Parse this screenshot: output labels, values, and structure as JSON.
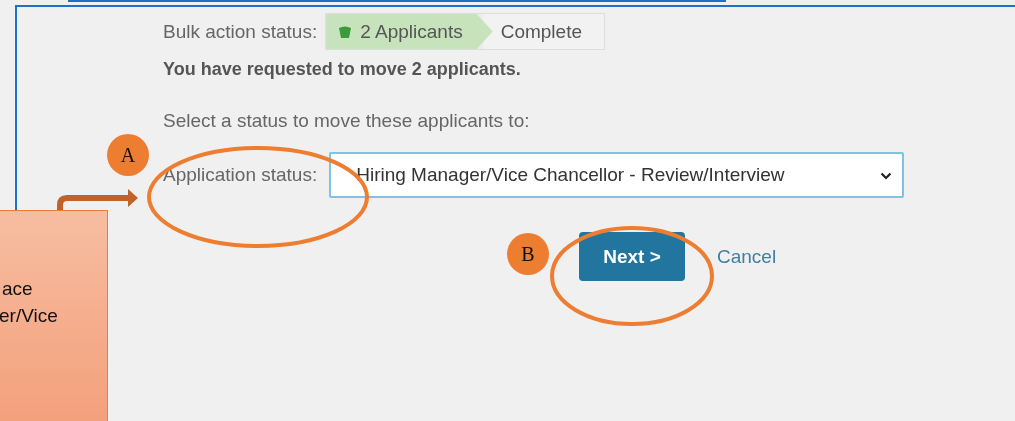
{
  "bulk_status": {
    "label": "Bulk action status:",
    "steps": [
      {
        "label": "2 Applicants",
        "selected": true
      },
      {
        "label": "Complete",
        "selected": false
      }
    ]
  },
  "message": "You have requested to move 2 applicants.",
  "prompt": "Select a status to move these applicants to:",
  "status_field": {
    "label": "Application status:",
    "value": "Hiring Manager/Vice Chancellor - Review/Interview"
  },
  "buttons": {
    "next": "Next >",
    "cancel": "Cancel"
  },
  "annotations": {
    "markers": [
      {
        "label": "A"
      },
      {
        "label": "B"
      }
    ],
    "callout": [
      "ace",
      "er/Vice"
    ]
  }
}
